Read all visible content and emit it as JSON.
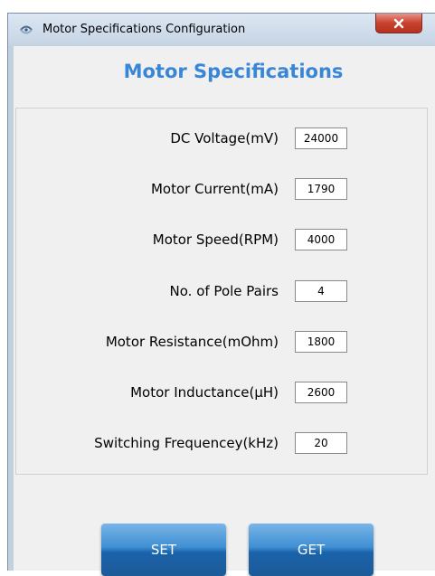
{
  "window": {
    "title": "Motor Specifications Configuration",
    "close_icon": "close-icon",
    "app_icon": "motor-app-icon"
  },
  "heading": "Motor Specifications",
  "fields": [
    {
      "label": "DC Voltage(mV)",
      "value": "24000"
    },
    {
      "label": "Motor Current(mA)",
      "value": "1790"
    },
    {
      "label": "Motor Speed(RPM)",
      "value": "4000"
    },
    {
      "label": "No. of Pole Pairs",
      "value": "4"
    },
    {
      "label": "Motor Resistance(mOhm)",
      "value": "1800"
    },
    {
      "label": "Motor Inductance(µH)",
      "value": "2600"
    },
    {
      "label": "Switching Frequencey(kHz)",
      "value": "20"
    }
  ],
  "buttons": {
    "set_label": "SET",
    "get_label": "GET"
  },
  "colors": {
    "heading": "#3a86d6",
    "button_top": "#79b5e8",
    "button_bottom": "#1d5a98",
    "close_button": "#c9412f"
  }
}
